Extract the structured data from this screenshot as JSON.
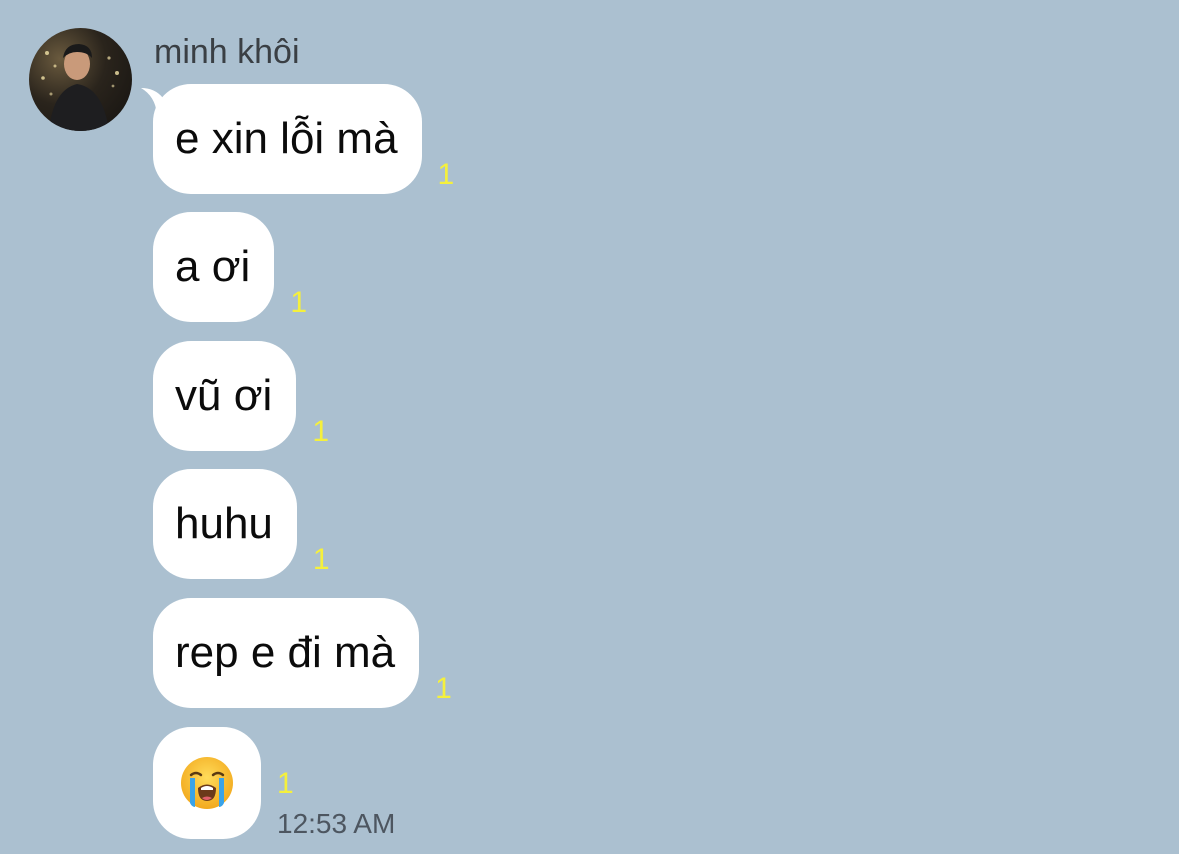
{
  "sender": {
    "name": "minh khôi"
  },
  "messages": [
    {
      "text": "e xin lỗi mà",
      "unread": "1"
    },
    {
      "text": "a ơi",
      "unread": "1"
    },
    {
      "text": "vũ ơi",
      "unread": "1"
    },
    {
      "text": "huhu",
      "unread": "1"
    },
    {
      "text": "rep e đi mà",
      "unread": "1"
    },
    {
      "emoji": "loudly-crying-face",
      "unread": "1",
      "time": "12:53 AM"
    }
  ],
  "colors": {
    "background": "#abc0d0",
    "bubble": "#ffffff",
    "unread": "#f5f03c"
  }
}
